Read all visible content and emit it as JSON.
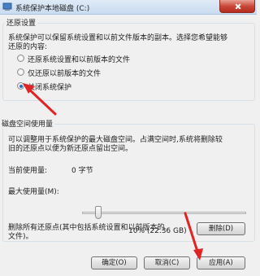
{
  "window": {
    "title": "系统保护本地磁盘 (C:)"
  },
  "restore_settings": {
    "group_title": "还原设置",
    "description": [
      "系统保护可以保留系统设置和以前文件版本的副本。选择您希望能够",
      "还原的内容:"
    ],
    "options": [
      {
        "label": "还原系统设置和以前版本的文件",
        "checked": false
      },
      {
        "label": "仅还原以前版本的文件",
        "checked": false
      },
      {
        "label": "关闭系统保护",
        "checked": true
      }
    ]
  },
  "disk_usage": {
    "group_title": "磁盘空间使用量",
    "description": [
      "可以调整用于系统保护的最大磁盘空间。占满空间时,系统将删除较",
      "旧的还原点以便为新还原点留出空间。"
    ],
    "current_label": "当前使用量:",
    "current_value": "0 字节",
    "max_label": "最大使用量(M):",
    "slider_percent": 10,
    "max_value": "10% (22.36 GB)"
  },
  "delete": {
    "text": [
      "删除所有还原点(其中包括系统设置和以前版本的",
      "文件)。"
    ],
    "button_label": "删除(D)"
  },
  "footer": {
    "ok_label": "确定(O)",
    "cancel_label": "取消(C)",
    "apply_label": "应用(A)"
  },
  "annotation_color": "#e02424"
}
